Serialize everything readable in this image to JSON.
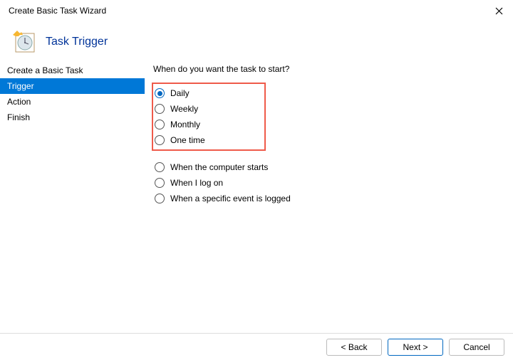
{
  "window": {
    "title": "Create Basic Task Wizard"
  },
  "header": {
    "title": "Task Trigger"
  },
  "sidebar": {
    "items": [
      {
        "label": "Create a Basic Task",
        "active": false
      },
      {
        "label": "Trigger",
        "active": true
      },
      {
        "label": "Action",
        "active": false
      },
      {
        "label": "Finish",
        "active": false
      }
    ]
  },
  "main": {
    "question": "When do you want the task to start?",
    "options": [
      {
        "label": "Daily",
        "checked": true,
        "highlighted": true
      },
      {
        "label": "Weekly",
        "checked": false,
        "highlighted": true
      },
      {
        "label": "Monthly",
        "checked": false,
        "highlighted": true
      },
      {
        "label": "One time",
        "checked": false,
        "highlighted": true
      },
      {
        "label": "When the computer starts",
        "checked": false,
        "highlighted": false
      },
      {
        "label": "When I log on",
        "checked": false,
        "highlighted": false
      },
      {
        "label": "When a specific event is logged",
        "checked": false,
        "highlighted": false
      }
    ]
  },
  "footer": {
    "back": "< Back",
    "next": "Next >",
    "cancel": "Cancel"
  }
}
